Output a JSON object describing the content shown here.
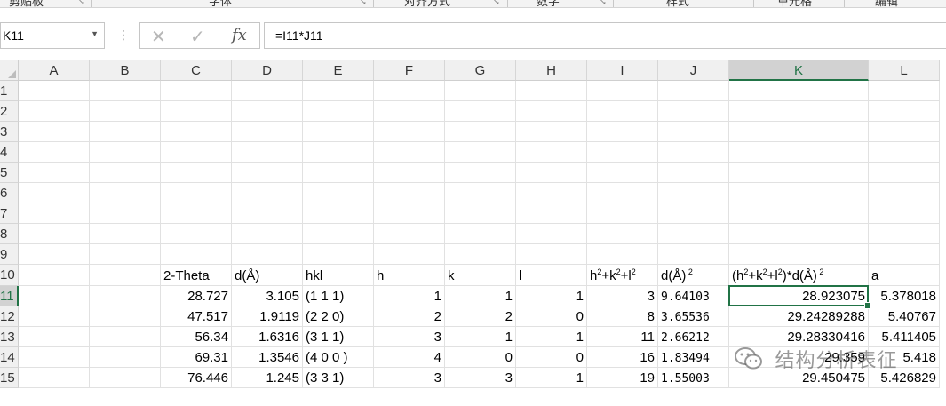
{
  "ribbon": {
    "groups": [
      "剪贴板",
      "字体",
      "对齐方式",
      "数字",
      "样式",
      "单元格",
      "编辑"
    ]
  },
  "formula_bar": {
    "name_box": "K11",
    "cancel_icon": "close-icon",
    "enter_icon": "check-icon",
    "fx_label": "fx",
    "formula": "=I11*J11"
  },
  "columns": [
    "A",
    "B",
    "C",
    "D",
    "E",
    "F",
    "G",
    "H",
    "I",
    "J",
    "K",
    "L"
  ],
  "rows": [
    "1",
    "2",
    "3",
    "4",
    "5",
    "6",
    "7",
    "8",
    "9",
    "10",
    "11",
    "12",
    "13",
    "14",
    "15"
  ],
  "selected": {
    "column": "K",
    "row": "11"
  },
  "table": {
    "headers": {
      "C": "2-Theta",
      "D": "d(Å)",
      "E": "hkl",
      "F": "h",
      "G": "k",
      "H": "l",
      "I": "h2+k2+l2",
      "J": "d(Å)2",
      "K": "(h2+k2+l2)*d(Å)2",
      "L": "a"
    },
    "rows": [
      {
        "C": "28.727",
        "D": "3.105",
        "E": "(1 1 1)",
        "F": "1",
        "G": "1",
        "H": "1",
        "I": "3",
        "J": "9.64103",
        "K": "28.923075",
        "L": "5.378018"
      },
      {
        "C": "47.517",
        "D": "1.9119",
        "E": "(2 2 0)",
        "F": "2",
        "G": "2",
        "H": "0",
        "I": "8",
        "J": "3.65536",
        "K": "29.24289288",
        "L": "5.40767"
      },
      {
        "C": "56.34",
        "D": "1.6316",
        "E": "(3 1 1)",
        "F": "3",
        "G": "1",
        "H": "1",
        "I": "11",
        "J": "2.66212",
        "K": "29.28330416",
        "L": "5.411405"
      },
      {
        "C": "69.31",
        "D": "1.3546",
        "E": "(4 0 0 )",
        "F": "4",
        "G": "0",
        "H": "0",
        "I": "16",
        "J": "1.83494",
        "K": "29.359",
        "L": "5.418"
      },
      {
        "C": "76.446",
        "D": "1.245",
        "E": "(3 3 1)",
        "F": "3",
        "G": "3",
        "H": "1",
        "I": "19",
        "J": "1.55003",
        "K": "29.450475",
        "L": "5.426829"
      }
    ]
  },
  "watermark": {
    "text": "结构分析表征",
    "icon": "wechat-icon"
  },
  "colors": {
    "accent": "#217346",
    "header_bg": "#f0f0f0",
    "selected_header_bg": "#d2d2d2"
  }
}
